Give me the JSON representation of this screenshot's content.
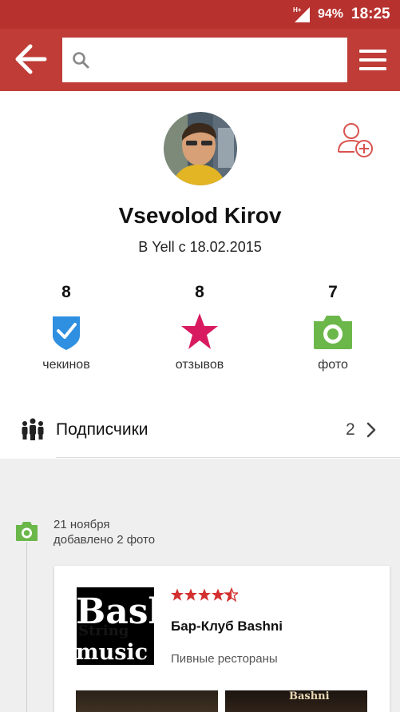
{
  "status_bar": {
    "network": "H+",
    "battery": "94%",
    "time": "18:25"
  },
  "app_bar": {
    "search": {
      "value": "",
      "placeholder": ""
    }
  },
  "profile": {
    "name": "Vsevolod Kirov",
    "member_since": "В Yell с 18.02.2015",
    "stats": [
      {
        "count": "8",
        "label": "чекинов",
        "icon": "checkin-shield-icon",
        "color": "#2f8fe0"
      },
      {
        "count": "8",
        "label": "отзывов",
        "icon": "star-icon",
        "color": "#d81b60"
      },
      {
        "count": "7",
        "label": "фото",
        "icon": "camera-icon",
        "color": "#6cb74a"
      }
    ],
    "followers": {
      "label": "Подписчики",
      "count": "2"
    }
  },
  "feed": {
    "item": {
      "date": "21 ноября",
      "description": "добавлено 2 фото",
      "place": {
        "logo_text_top": "Bash",
        "logo_text_bottom": "music c",
        "rating": 4.5,
        "name": "Бар-Клуб Bashni",
        "category": "Пивные рестораны",
        "photo_caption": "Bashni"
      }
    }
  },
  "colors": {
    "status_bar": "#b7322f",
    "app_bar": "#bf3c37",
    "accent_red": "#d9534f",
    "rating_star": "#d32f2f"
  }
}
